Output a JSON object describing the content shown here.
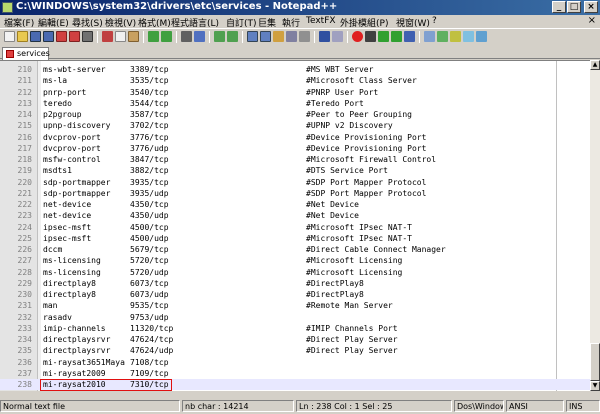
{
  "window": {
    "title": "C:\\WINDOWS\\system32\\drivers\\etc\\services - Notepad++"
  },
  "menu": [
    "檔案(F)",
    "編輯(E)",
    "尋找(S)",
    "檢視(V)",
    "格式(M)",
    "程式語言(L)",
    "自訂(T)",
    "巨集",
    "執行",
    "TextFX",
    "外掛模組(P)",
    "視窗(W)",
    "?"
  ],
  "tab": {
    "label": "services"
  },
  "lines": [
    {
      "n": "210",
      "name": "ms-wbt-server",
      "port": "3389/tcp",
      "comment": "#MS WBT Server"
    },
    {
      "n": "211",
      "name": "ms-la",
      "port": "3535/tcp",
      "comment": "#Microsoft Class Server"
    },
    {
      "n": "212",
      "name": "pnrp-port",
      "port": "3540/tcp",
      "comment": "#PNRP User Port"
    },
    {
      "n": "213",
      "name": "teredo",
      "port": "3544/tcp",
      "comment": "#Teredo Port"
    },
    {
      "n": "214",
      "name": "p2pgroup",
      "port": "3587/tcp",
      "comment": "#Peer to Peer Grouping"
    },
    {
      "n": "215",
      "name": "upnp-discovery",
      "port": "3702/tcp",
      "comment": "#UPNP v2 Discovery"
    },
    {
      "n": "216",
      "name": "dvcprov-port",
      "port": "3776/tcp",
      "comment": "#Device Provisioning Port"
    },
    {
      "n": "217",
      "name": "dvcprov-port",
      "port": "3776/udp",
      "comment": "#Device Provisioning Port"
    },
    {
      "n": "218",
      "name": "msfw-control",
      "port": "3847/tcp",
      "comment": "#Microsoft Firewall Control"
    },
    {
      "n": "219",
      "name": "msdts1",
      "port": "3882/tcp",
      "comment": "#DTS Service Port"
    },
    {
      "n": "220",
      "name": "sdp-portmapper",
      "port": "3935/tcp",
      "comment": "#SDP Port Mapper Protocol"
    },
    {
      "n": "221",
      "name": "sdp-portmapper",
      "port": "3935/udp",
      "comment": "#SDP Port Mapper Protocol"
    },
    {
      "n": "222",
      "name": "net-device",
      "port": "4350/tcp",
      "comment": "#Net Device"
    },
    {
      "n": "223",
      "name": "net-device",
      "port": "4350/udp",
      "comment": "#Net Device"
    },
    {
      "n": "224",
      "name": "ipsec-msft",
      "port": "4500/tcp",
      "comment": "#Microsoft IPsec NAT-T"
    },
    {
      "n": "225",
      "name": "ipsec-msft",
      "port": "4500/udp",
      "comment": "#Microsoft IPsec NAT-T"
    },
    {
      "n": "226",
      "name": "dccm",
      "port": "5679/tcp",
      "comment": "#Direct Cable Connect Manager"
    },
    {
      "n": "227",
      "name": "ms-licensing",
      "port": "5720/tcp",
      "comment": "#Microsoft Licensing"
    },
    {
      "n": "228",
      "name": "ms-licensing",
      "port": "5720/udp",
      "comment": "#Microsoft Licensing"
    },
    {
      "n": "229",
      "name": "directplay8",
      "port": "6073/tcp",
      "comment": "#DirectPlay8"
    },
    {
      "n": "230",
      "name": "directplay8",
      "port": "6073/udp",
      "comment": "#DirectPlay8"
    },
    {
      "n": "231",
      "name": "man",
      "port": "9535/tcp",
      "comment": "#Remote Man Server"
    },
    {
      "n": "232",
      "name": "rasadv",
      "port": "9753/udp",
      "comment": ""
    },
    {
      "n": "233",
      "name": "imip-channels",
      "port": "11320/tcp",
      "comment": "#IMIP Channels Port"
    },
    {
      "n": "234",
      "name": "directplaysrvr",
      "port": "47624/tcp",
      "comment": "#Direct Play Server"
    },
    {
      "n": "235",
      "name": "directplaysrvr",
      "port": "47624/udp",
      "comment": "#Direct Play Server"
    },
    {
      "n": "236",
      "name": "mi-raysat3651Maya",
      "port": "7108/tcp",
      "comment": ""
    },
    {
      "n": "237",
      "name": "mi-raysat2009",
      "port": "7109/tcp",
      "comment": ""
    },
    {
      "n": "238",
      "name": "mi-raysat2010",
      "port": "7310/tcp",
      "comment": ""
    }
  ],
  "status": {
    "file_type": "Normal text file",
    "length": "nb char : 14214",
    "position": "Ln : 238   Col : 1   Sel : 25",
    "eol": "Dos\\Windows",
    "encoding": "ANSI",
    "mode": "INS"
  },
  "colors": {
    "title_start": "#0a246a",
    "title_end": "#3a6ea5",
    "highlight_box": "#e01010"
  }
}
